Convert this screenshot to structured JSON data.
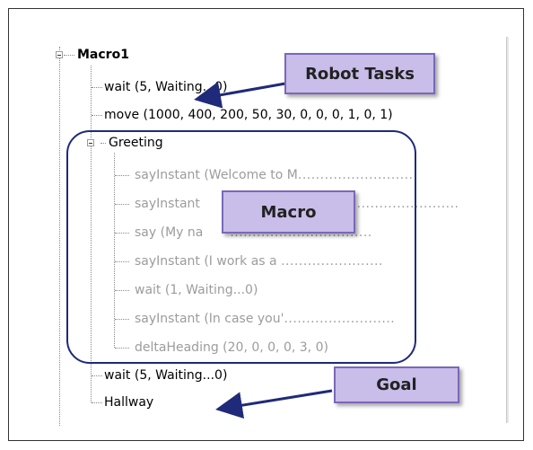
{
  "tree": {
    "root": "Macro1",
    "items": [
      {
        "text": "wait (5, Waiting...0)"
      },
      {
        "text": "move (1000, 400, 200, 50, 30, 0, 0, 0, 1, 0, 1)"
      },
      {
        "text": "Greeting",
        "children": [
          {
            "text": "sayInstant (Welcome to M",
            "dots": "..........................."
          },
          {
            "text": "sayInstant",
            "dots": "............................"
          },
          {
            "text": "say (My na",
            "dots": "................................"
          },
          {
            "text": "sayInstant (I work as a ",
            "dots": "......................."
          },
          {
            "text": "wait (1, Waiting...0)",
            "dots": ""
          },
          {
            "text": "sayInstant (In case you'",
            "dots": "........................."
          },
          {
            "text": "deltaHeading (20, 0, 0, 0, 3, 0)",
            "dots": ""
          }
        ]
      },
      {
        "text": "wait (5, Waiting...0)"
      },
      {
        "text": "Hallway"
      }
    ]
  },
  "callouts": {
    "robot_tasks": "Robot Tasks",
    "macro": "Macro",
    "goal": "Goal"
  },
  "colors": {
    "callout_fill": "#c9bde9",
    "callout_border": "#7a68b8",
    "outline": "#1f2a7a",
    "arrow": "#1f2a7a"
  }
}
